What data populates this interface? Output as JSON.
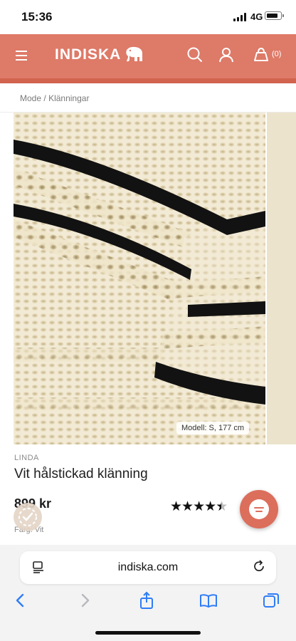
{
  "status_bar": {
    "time": "15:36",
    "network": "4G"
  },
  "header": {
    "logo_text": "INDISKA",
    "cart_count": "(0)"
  },
  "breadcrumb": {
    "items": [
      "Mode",
      "Klänningar"
    ],
    "separator": "/"
  },
  "product_image": {
    "model_info": "Modell: S, 177 cm"
  },
  "product": {
    "brand": "LINDA",
    "name": "Vit hålstickad klänning",
    "price": "899 kr",
    "rating_stars": 4.5,
    "color_label": "Färg: Vit"
  },
  "browser": {
    "url": "indiska.com"
  },
  "colors": {
    "header": "#de7a68",
    "accent": "#dc6e5c",
    "fabric": "#f0e7d0",
    "stripe": "#111111"
  }
}
